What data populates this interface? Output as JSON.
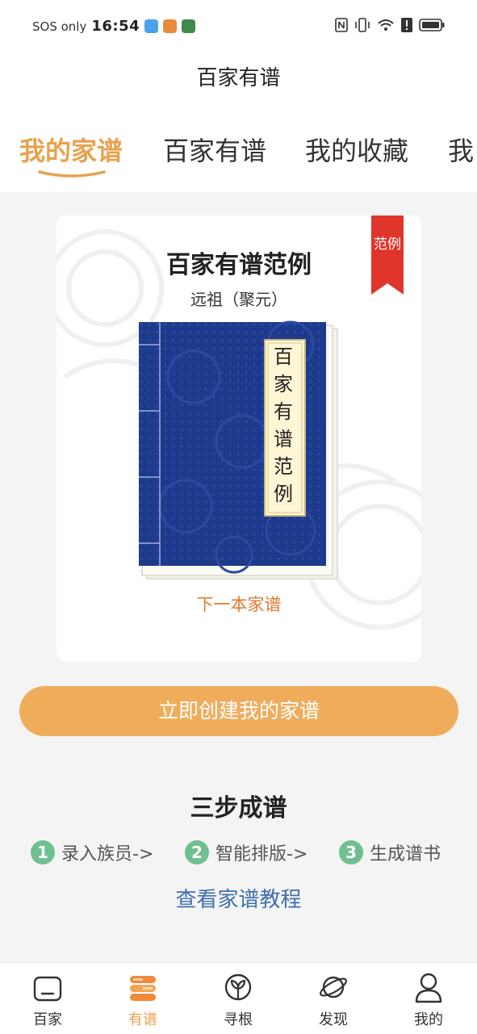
{
  "status_bar": {
    "carrier": "SOS only",
    "time": "16:54",
    "icons": [
      "app-icon-blue",
      "app-icon-orange",
      "app-icon-green",
      "nfc-icon",
      "vibrate-icon",
      "wifi-icon",
      "alert-icon",
      "battery-icon"
    ]
  },
  "header": {
    "title": "百家有谱"
  },
  "tabs": [
    {
      "label": "我的家谱",
      "active": true
    },
    {
      "label": "百家有谱",
      "active": false
    },
    {
      "label": "我的收藏",
      "active": false
    },
    {
      "label": "我",
      "active": false
    }
  ],
  "card": {
    "ribbon": "范例",
    "title": "百家有谱范例",
    "subtitle": "远祖（聚元）",
    "book_label": "百家有谱范例",
    "next_link": "下一本家谱"
  },
  "create_button": "立即创建我的家谱",
  "steps_section": {
    "title": "三步成谱",
    "steps": [
      {
        "num": "1",
        "label": "录入族员->"
      },
      {
        "num": "2",
        "label": "智能排版->"
      },
      {
        "num": "3",
        "label": "生成谱书"
      }
    ],
    "tutorial_link": "查看家谱教程"
  },
  "bottom_nav": [
    {
      "label": "百家",
      "icon": "home-icon",
      "active": false
    },
    {
      "label": "有谱",
      "icon": "books-icon",
      "active": true
    },
    {
      "label": "寻根",
      "icon": "sprout-icon",
      "active": false
    },
    {
      "label": "发现",
      "icon": "planet-icon",
      "active": false
    },
    {
      "label": "我的",
      "icon": "profile-icon",
      "active": false
    }
  ],
  "colors": {
    "accent": "#e8a24f",
    "button": "#efad5c",
    "ribbon": "#e0352b",
    "book_cover": "#1e3a8c",
    "link": "#3f6fae",
    "step_badge": "#6fbf8f"
  }
}
